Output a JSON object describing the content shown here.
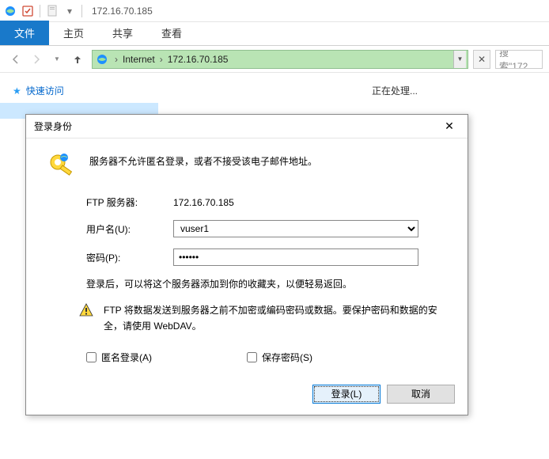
{
  "titlebar": {
    "address": "172.16.70.185"
  },
  "ribbon": {
    "tabs": [
      {
        "label": "文件",
        "active": true
      },
      {
        "label": "主页",
        "active": false
      },
      {
        "label": "共享",
        "active": false
      },
      {
        "label": "查看",
        "active": false
      }
    ]
  },
  "nav": {
    "crumb1": "Internet",
    "crumb2": "172.16.70.185",
    "search_placeholder": "搜索\"172."
  },
  "sidebar": {
    "quick_access": "快速访问"
  },
  "main": {
    "status": "正在处理..."
  },
  "dialog": {
    "title": "登录身份",
    "message": "服务器不允许匿名登录，或者不接受该电子邮件地址。",
    "server_label": "FTP 服务器:",
    "server_value": "172.16.70.185",
    "user_label": "用户名(U):",
    "user_value": "vuser1",
    "pass_label": "密码(P):",
    "pass_value": "••••••",
    "note": "登录后，可以将这个服务器添加到你的收藏夹，以便轻易返回。",
    "warning": "FTP 将数据发送到服务器之前不加密或编码密码或数据。要保护密码和数据的安全，请使用 WebDAV。",
    "anon_label": "匿名登录(A)",
    "save_label": "保存密码(S)",
    "login_btn": "登录(L)",
    "cancel_btn": "取消"
  }
}
